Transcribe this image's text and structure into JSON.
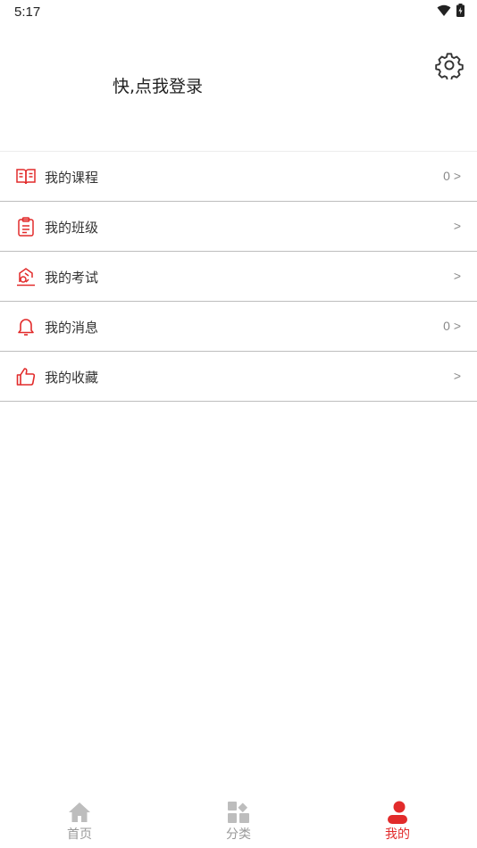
{
  "status_bar": {
    "time": "5:17"
  },
  "header": {
    "login_text": "快,点我登录"
  },
  "menu": {
    "items": [
      {
        "label": "我的课程",
        "value": "0 >"
      },
      {
        "label": "我的班级",
        "value": ">"
      },
      {
        "label": "我的考试",
        "value": ">"
      },
      {
        "label": "我的消息",
        "value": "0 >"
      },
      {
        "label": "我的收藏",
        "value": ">"
      }
    ]
  },
  "bottom_nav": {
    "items": [
      {
        "label": "首页",
        "icon": "home-icon"
      },
      {
        "label": "分类",
        "icon": "category-icon"
      },
      {
        "label": "我的",
        "icon": "user-icon",
        "active": true
      }
    ]
  },
  "colors": {
    "accent": "#e22b2b",
    "inactive": "#999999",
    "icon_gray": "#bdbdbd"
  }
}
